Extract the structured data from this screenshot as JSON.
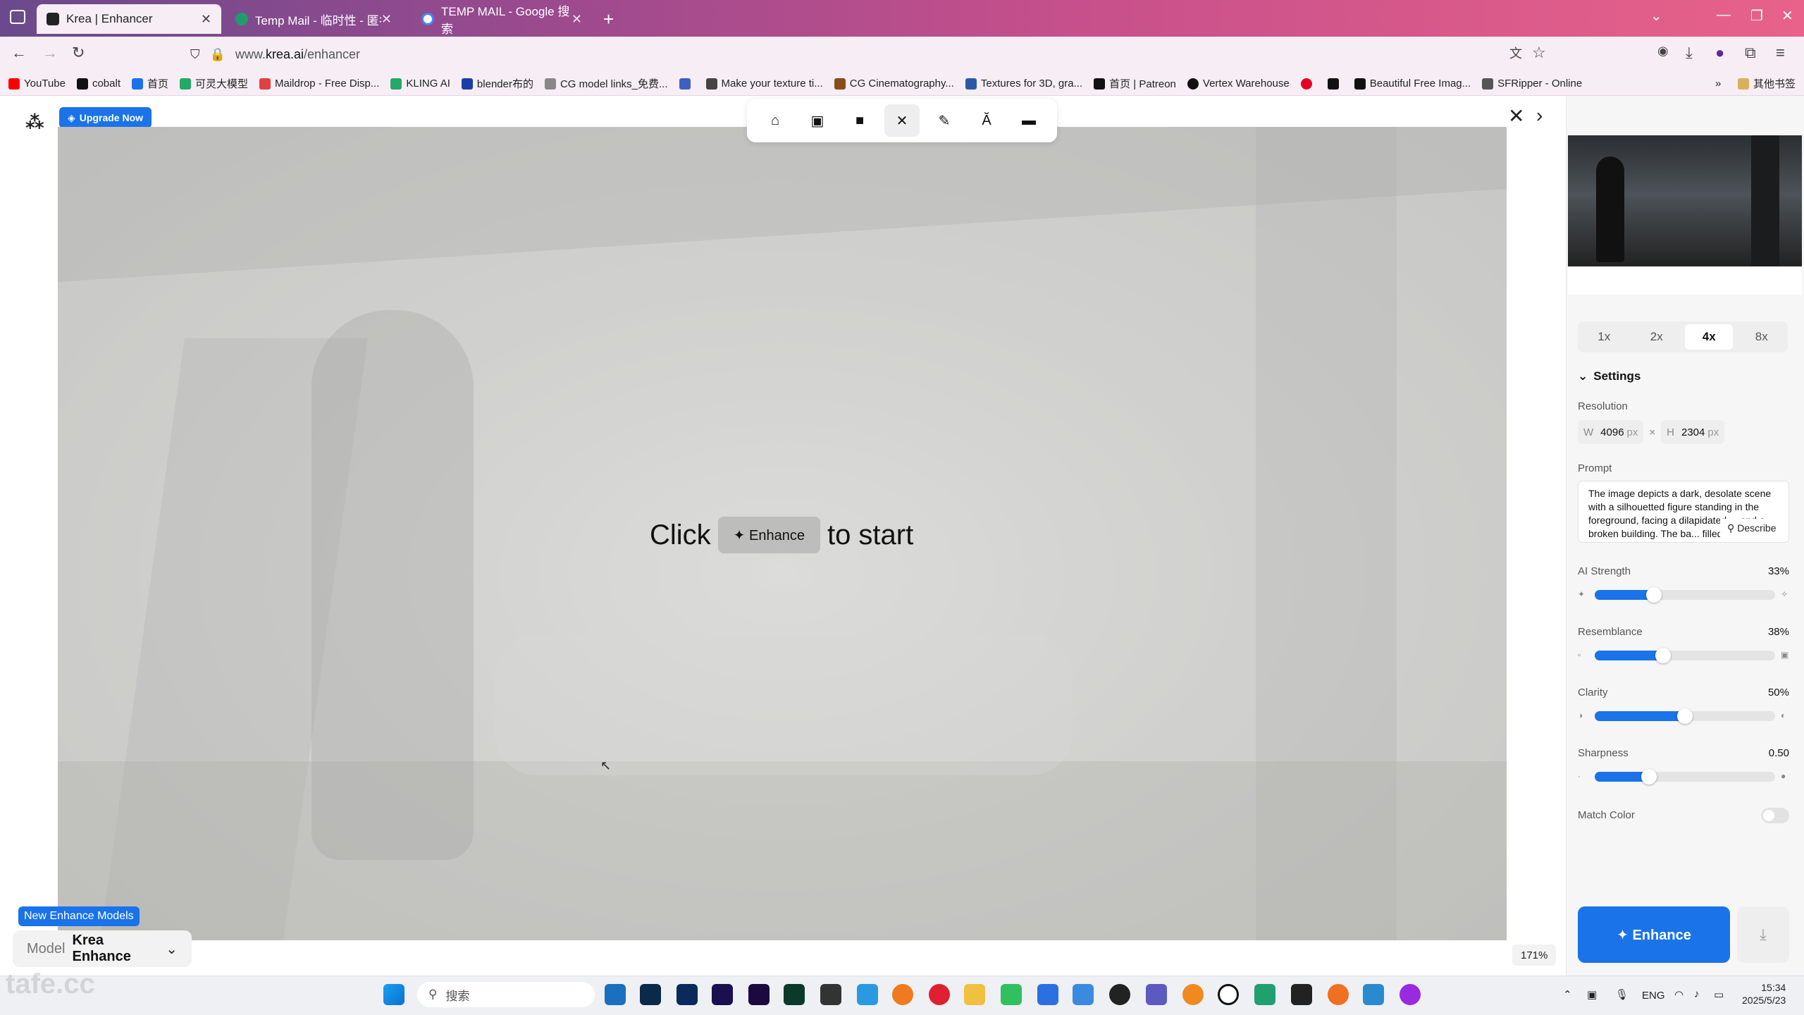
{
  "browser": {
    "tabs": [
      {
        "title": "Krea | Enhancer",
        "active": true,
        "color": "#222222"
      },
      {
        "title": "Temp Mail - 临时性 - 匿名电子",
        "active": false,
        "color": "#1e9c6b"
      },
      {
        "title": "TEMP MAIL - Google 搜索",
        "active": false,
        "color": "#4285f4"
      }
    ],
    "url_prefix": "www.",
    "url_domain": "krea.ai",
    "url_path": "/enhancer",
    "bookmarks": [
      {
        "label": "YouTube",
        "color": "#ff0000"
      },
      {
        "label": "cobalt",
        "color": "#111111"
      },
      {
        "label": "首页",
        "color": "#1a73e8"
      },
      {
        "label": "可灵大模型",
        "color": "#22aa66"
      },
      {
        "label": "Maildrop - Free Disp...",
        "color": "#e04040"
      },
      {
        "label": "KLING AI",
        "color": "#22aa66"
      },
      {
        "label": "blender布的",
        "color": "#1a3fa8"
      },
      {
        "label": "CG model links_免费...",
        "color": "#888888"
      },
      {
        "label": "",
        "color": "#4060c0"
      },
      {
        "label": "Make your texture ti...",
        "color": "#444444"
      },
      {
        "label": "CG Cinematography...",
        "color": "#8a4a1a"
      },
      {
        "label": "Textures for 3D, gra...",
        "color": "#2a5aa8"
      },
      {
        "label": "首页 | Patreon",
        "color": "#111111"
      },
      {
        "label": "Vertex Warehouse",
        "color": "#111111"
      },
      {
        "label": "",
        "color": "#e60023"
      },
      {
        "label": "",
        "color": "#111111"
      },
      {
        "label": "Beautiful Free Imag...",
        "color": "#111111"
      },
      {
        "label": "SFRipper - Online",
        "color": "#555555"
      }
    ],
    "other_bookmarks": "其他书签"
  },
  "app": {
    "upgrade_label": "Upgrade Now",
    "start_click": "Click",
    "start_button": "✦ Enhance",
    "start_suffix": "to start",
    "new_models_badge": "New Enhance Models",
    "model_key": "Model",
    "model_value": "Krea Enhance",
    "zoom": "171%"
  },
  "panel": {
    "scales": [
      "1x",
      "2x",
      "4x",
      "8x"
    ],
    "active_scale": "4x",
    "settings_label": "Settings",
    "resolution_label": "Resolution",
    "width_label": "W",
    "width_value": "4096",
    "height_label": "H",
    "height_value": "2304",
    "unit": "px",
    "prompt_label": "Prompt",
    "prompt_text": "The image depicts a dark, desolate scene with a silhouetted figure standing in the foreground, facing a dilapidated ... and a broken building. The ba... filled with ruins and debris, creating a",
    "describe_label": "Describe",
    "sliders": [
      {
        "label": "AI Strength",
        "value": "33%",
        "level": 0.33
      },
      {
        "label": "Resemblance",
        "value": "38%",
        "level": 0.38
      },
      {
        "label": "Clarity",
        "value": "50%",
        "level": 0.5
      },
      {
        "label": "Sharpness",
        "value": "0.50",
        "level": 0.3
      }
    ],
    "match_color_label": "Match Color",
    "enhance_button": "✦ Enhance"
  },
  "taskbar": {
    "search_placeholder": "搜索",
    "lang": "ENG",
    "time": "15:34",
    "date": "2025/5/23"
  },
  "watermark": "tafe.cc"
}
